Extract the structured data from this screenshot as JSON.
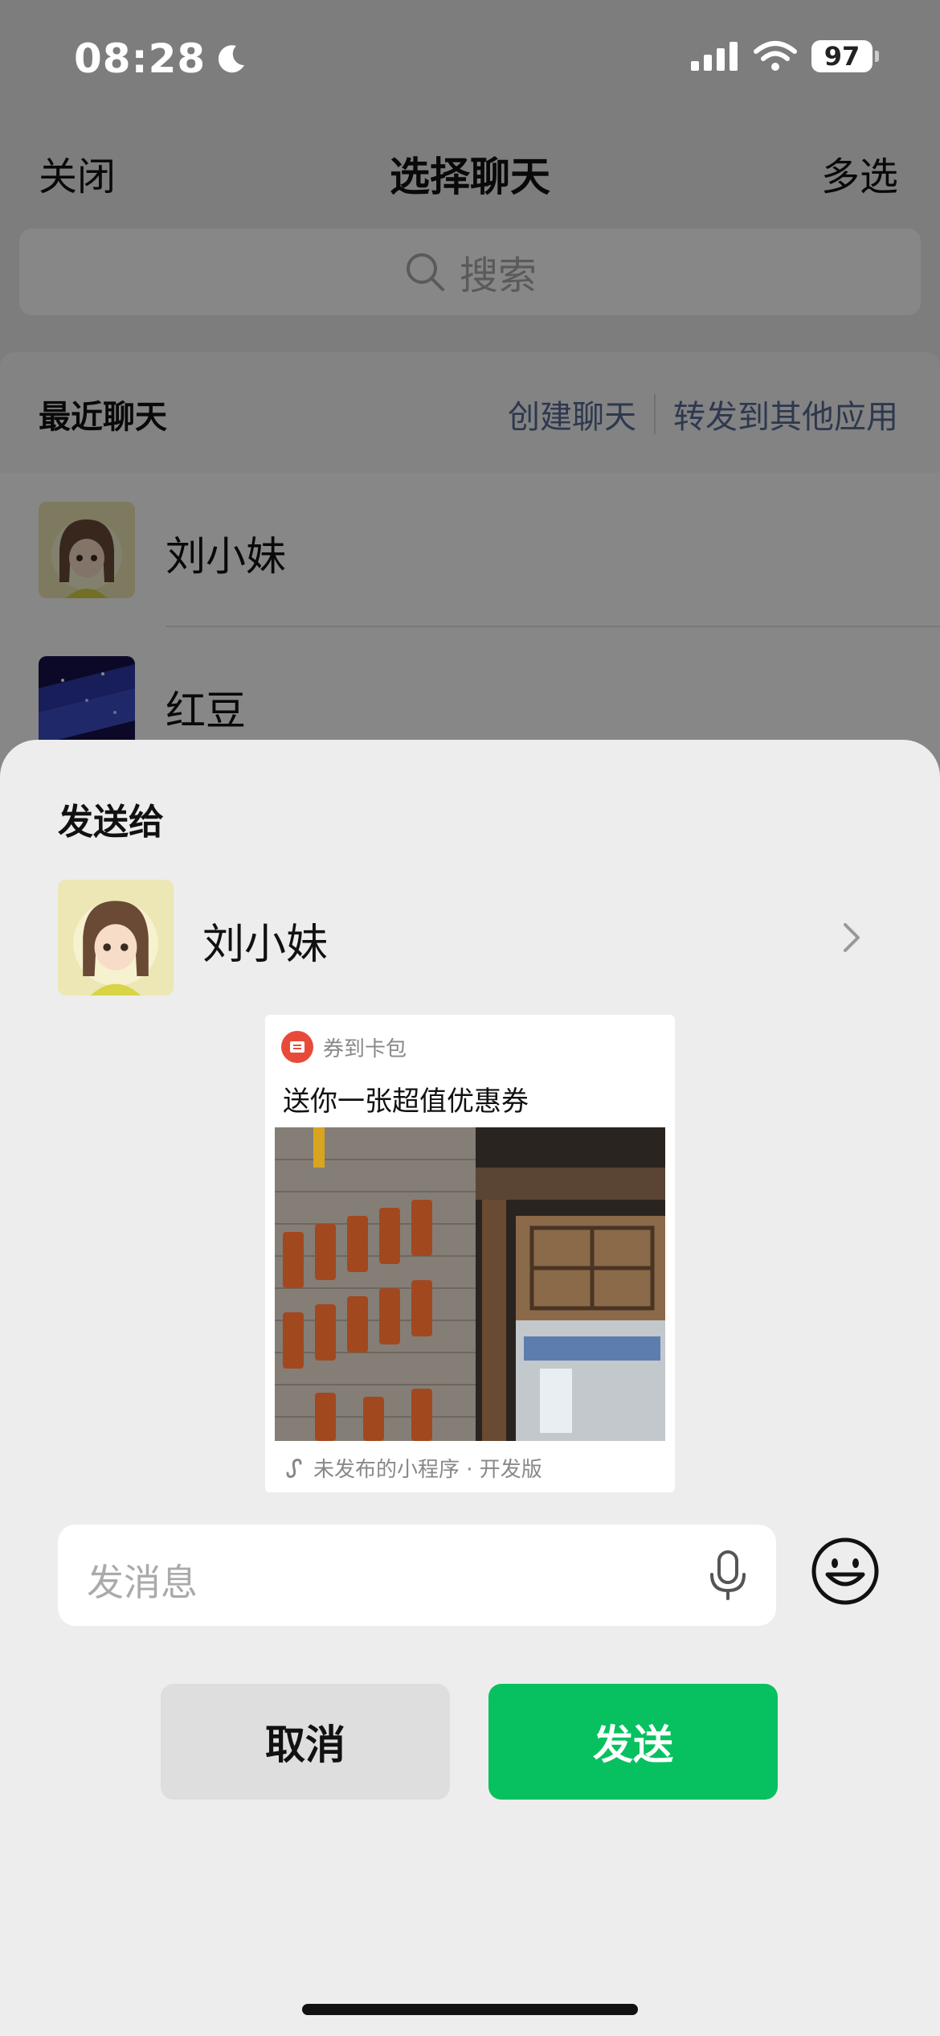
{
  "status_bar": {
    "time": "08:28",
    "battery": "97"
  },
  "nav": {
    "close_label": "关闭",
    "title": "选择聊天",
    "multi_select_label": "多选"
  },
  "search": {
    "placeholder": "搜索"
  },
  "recent": {
    "title": "最近聊天",
    "create_chat_label": "创建聊天",
    "forward_other_apps_label": "转发到其他应用",
    "chats": [
      {
        "name": "刘小妹"
      },
      {
        "name": "红豆"
      }
    ]
  },
  "sheet": {
    "title": "发送给",
    "recipient_name": "刘小妹",
    "card": {
      "app_name": "券到卡包",
      "title": "送你一张超值优惠券",
      "footer": "未发布的小程序 · 开发版"
    },
    "message_placeholder": "发消息",
    "cancel_label": "取消",
    "send_label": "发送"
  },
  "colors": {
    "accent_green": "#07c160",
    "link_blue": "#576b95",
    "sheet_bg": "#ededed"
  }
}
